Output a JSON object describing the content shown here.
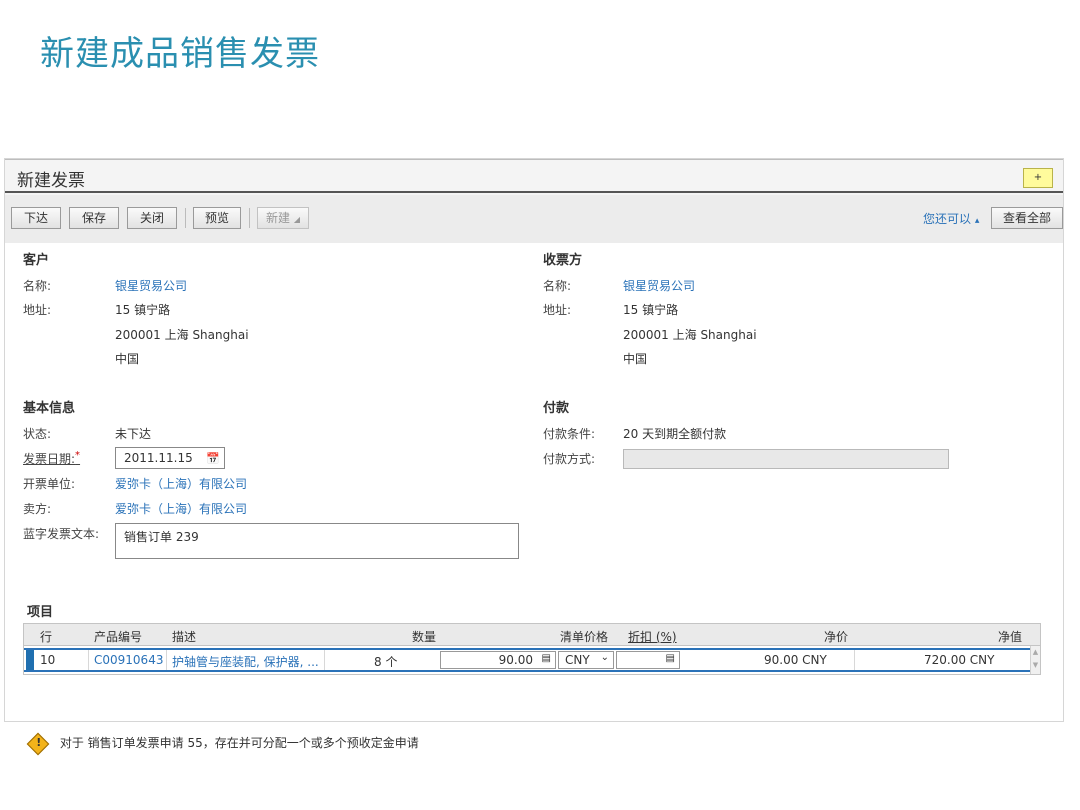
{
  "slide_title": "新建成品销售发票",
  "window": {
    "title": "新建发票",
    "note_icon": "sticky-note-icon",
    "note_glyph": "+"
  },
  "toolbar": {
    "release": "下达",
    "save": "保存",
    "close": "关闭",
    "preview": "预览",
    "new": "新建",
    "you_can": "您还可以",
    "view_all": "查看全部"
  },
  "customer": {
    "heading": "客户",
    "name_label": "名称:",
    "name": "银星贸易公司",
    "address_label": "地址:",
    "address_line1": "15 镇宁路",
    "address_line2": "200001 上海 Shanghai",
    "address_line3": "中国"
  },
  "bill_to": {
    "heading": "收票方",
    "name_label": "名称:",
    "name": "银星贸易公司",
    "address_label": "地址:",
    "address_line1": "15 镇宁路",
    "address_line2": "200001 上海 Shanghai",
    "address_line3": "中国"
  },
  "basic_info": {
    "heading": "基本信息",
    "status_label": "状态:",
    "status": "未下达",
    "invoice_date_label": "发票日期:",
    "invoice_date_required": "*",
    "invoice_date": "2011.11.15",
    "issuer_label": "开票单位:",
    "issuer": "爱弥卡（上海）有限公司",
    "seller_label": "卖方:",
    "seller": "爱弥卡（上海）有限公司",
    "blue_text_label": "蓝字发票文本:",
    "blue_text": "销售订单 239"
  },
  "payment": {
    "heading": "付款",
    "terms_label": "付款条件:",
    "terms": "20 天到期全额付款",
    "method_label": "付款方式:",
    "method": ""
  },
  "items": {
    "title": "项目",
    "headers": {
      "line": "行",
      "product_id": "产品编号",
      "description": "描述",
      "quantity": "数量",
      "list_price": "清单价格",
      "discount": "折扣 (%)",
      "net_price": "净价",
      "net_value": "净值"
    },
    "rows": [
      {
        "line": "10",
        "product_id": "C00910643",
        "description": "护轴管与座装配, 保护器, ...",
        "quantity": "8 个",
        "list_price": "90.00",
        "currency": "CNY",
        "discount": "",
        "net_price": "90.00 CNY",
        "net_value": "720.00 CNY"
      }
    ]
  },
  "message": "对于 销售订单发票申请 55，存在并可分配一个或多个预收定金申请"
}
